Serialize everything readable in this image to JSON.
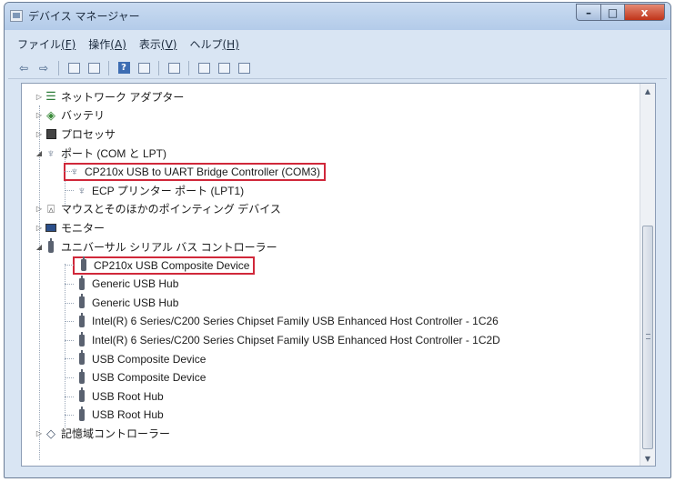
{
  "window": {
    "title": "デバイス マネージャー",
    "caption": {
      "minimize": "–",
      "maximize": "□",
      "close": "x"
    }
  },
  "menu": [
    {
      "text": "ファイル",
      "key": "(F)"
    },
    {
      "text": "操作",
      "key": "(A)"
    },
    {
      "text": "表示",
      "key": "(V)"
    },
    {
      "text": "ヘルプ",
      "key": "(H)"
    }
  ],
  "toolbar": {
    "back_icon": "back-arrow-icon",
    "forward_icon": "forward-arrow-icon",
    "back_glyph": "⇦",
    "forward_glyph": "⇨",
    "help_glyph": "?"
  },
  "tree": {
    "items": [
      {
        "label": "ネットワーク アダプター",
        "icon": "network-adapter-icon",
        "state": "collapsed"
      },
      {
        "label": "バッテリ",
        "icon": "battery-icon",
        "state": "collapsed"
      },
      {
        "label": "プロセッサ",
        "icon": "processor-icon",
        "state": "collapsed"
      },
      {
        "label": "ポート (COM と LPT)",
        "icon": "port-icon",
        "state": "expanded",
        "children": [
          {
            "label": "CP210x USB to UART Bridge Controller (COM3)",
            "icon": "port-icon",
            "highlighted": true
          },
          {
            "label": "ECP プリンター ポート (LPT1)",
            "icon": "port-icon",
            "highlighted": false
          }
        ]
      },
      {
        "label": "マウスとそのほかのポインティング デバイス",
        "icon": "mouse-icon",
        "state": "collapsed"
      },
      {
        "label": "モニター",
        "icon": "monitor-icon",
        "state": "collapsed"
      },
      {
        "label": "ユニバーサル シリアル バス コントローラー",
        "icon": "usb-icon",
        "state": "expanded",
        "children": [
          {
            "label": "CP210x USB Composite Device",
            "icon": "usb-icon",
            "highlighted": true
          },
          {
            "label": "Generic USB Hub",
            "icon": "usb-icon",
            "highlighted": false
          },
          {
            "label": "Generic USB Hub",
            "icon": "usb-icon",
            "highlighted": false
          },
          {
            "label": "Intel(R) 6 Series/C200 Series Chipset Family USB Enhanced Host Controller - 1C26",
            "icon": "usb-icon",
            "highlighted": false
          },
          {
            "label": "Intel(R) 6 Series/C200 Series Chipset Family USB Enhanced Host Controller - 1C2D",
            "icon": "usb-icon",
            "highlighted": false
          },
          {
            "label": "USB Composite Device",
            "icon": "usb-icon",
            "highlighted": false
          },
          {
            "label": "USB Composite Device",
            "icon": "usb-icon",
            "highlighted": false
          },
          {
            "label": "USB Root Hub",
            "icon": "usb-icon",
            "highlighted": false
          },
          {
            "label": "USB Root Hub",
            "icon": "usb-icon",
            "highlighted": false
          }
        ]
      },
      {
        "label": "記憶域コントローラー",
        "icon": "storage-controller-icon",
        "state": "collapsed"
      }
    ]
  },
  "colors": {
    "highlight_border": "#d0283a",
    "window_frame": "#d9e5f3",
    "close_button": "#c0341a"
  },
  "scrollbar": {
    "position": 0.74
  }
}
